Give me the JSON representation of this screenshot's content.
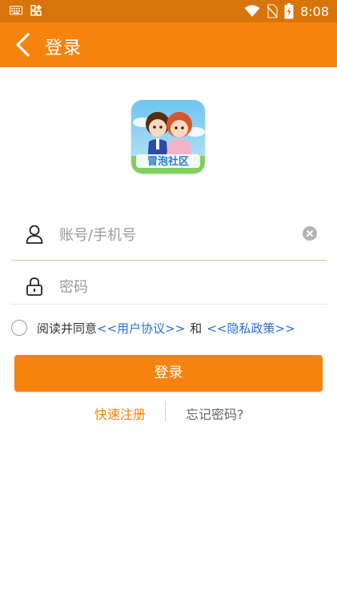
{
  "status_bar": {
    "time": "8:08"
  },
  "header": {
    "title": "登录"
  },
  "logo": {
    "text": "冒泡社区"
  },
  "account": {
    "placeholder": "账号/手机号",
    "value": ""
  },
  "password": {
    "placeholder": "密码",
    "value": ""
  },
  "agreement": {
    "prefix": "阅读并同意",
    "user_agreement": "<<用户协议>>",
    "and": "和",
    "privacy_policy": "<<隐私政策>>"
  },
  "login_button": "登录",
  "register_link": "快速注册",
  "forgot_link": "忘记密码?",
  "colors": {
    "accent": "#f5830e",
    "status_bar": "#d8750a",
    "link": "#2a6fd6"
  }
}
